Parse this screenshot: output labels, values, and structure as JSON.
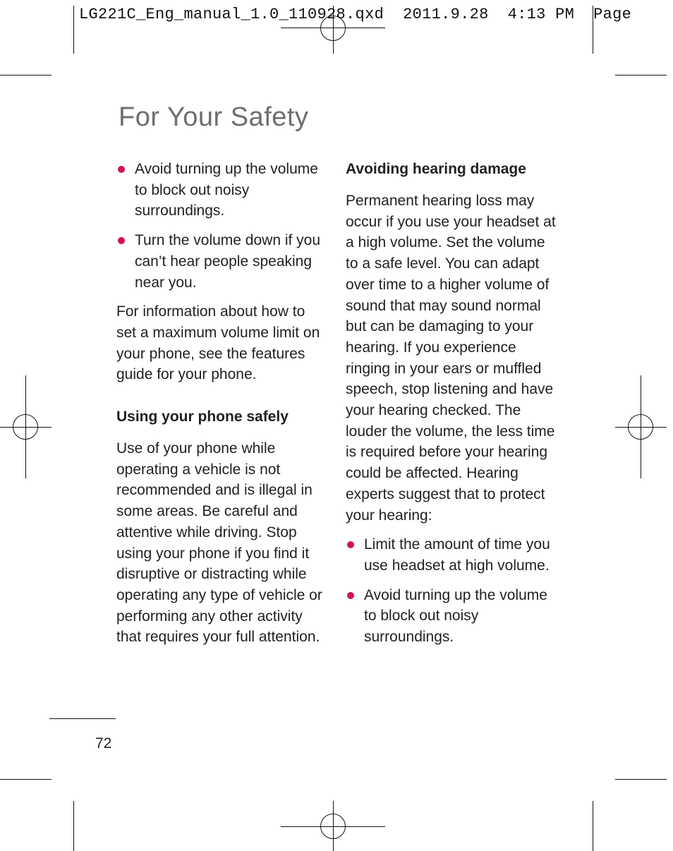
{
  "slug": "LG221C_Eng_manual_1.0_110928.qxd  2011.9.28  4:13 PM  Page",
  "title": "For Your Safety",
  "accent_color": "#d1105a",
  "left": {
    "bullets": [
      "Avoid turning up the volume to block out noisy surroundings.",
      "Turn the volume down if you can’t hear people speaking near you."
    ],
    "para1": "For information about how to set a maximum volume limit on your phone, see the features guide for your phone.",
    "heading": "Using your phone safely",
    "para2": "Use of your phone while operating a vehicle is not recommended and is illegal in some areas. Be careful and attentive while driving. Stop using your phone if you find it disruptive or distracting while operating any type of vehicle or performing any other activity that requires your full attention."
  },
  "right": {
    "heading": "Avoiding hearing damage",
    "para": "Permanent hearing loss may occur if you use your headset at a high volume. Set the volume to a safe level. You can adapt over time to a higher volume of sound that may sound normal but can be damaging to your hearing. If you experience ringing in your ears or muffled speech, stop listening and have your hearing checked. The louder the volume, the less time is required before your hearing could be affected. Hearing experts suggest that to protect your hearing:",
    "bullets": [
      "Limit the amount of time you use headset at high volume.",
      "Avoid turning up the volume to block out noisy surroundings."
    ]
  },
  "page_number": "72"
}
